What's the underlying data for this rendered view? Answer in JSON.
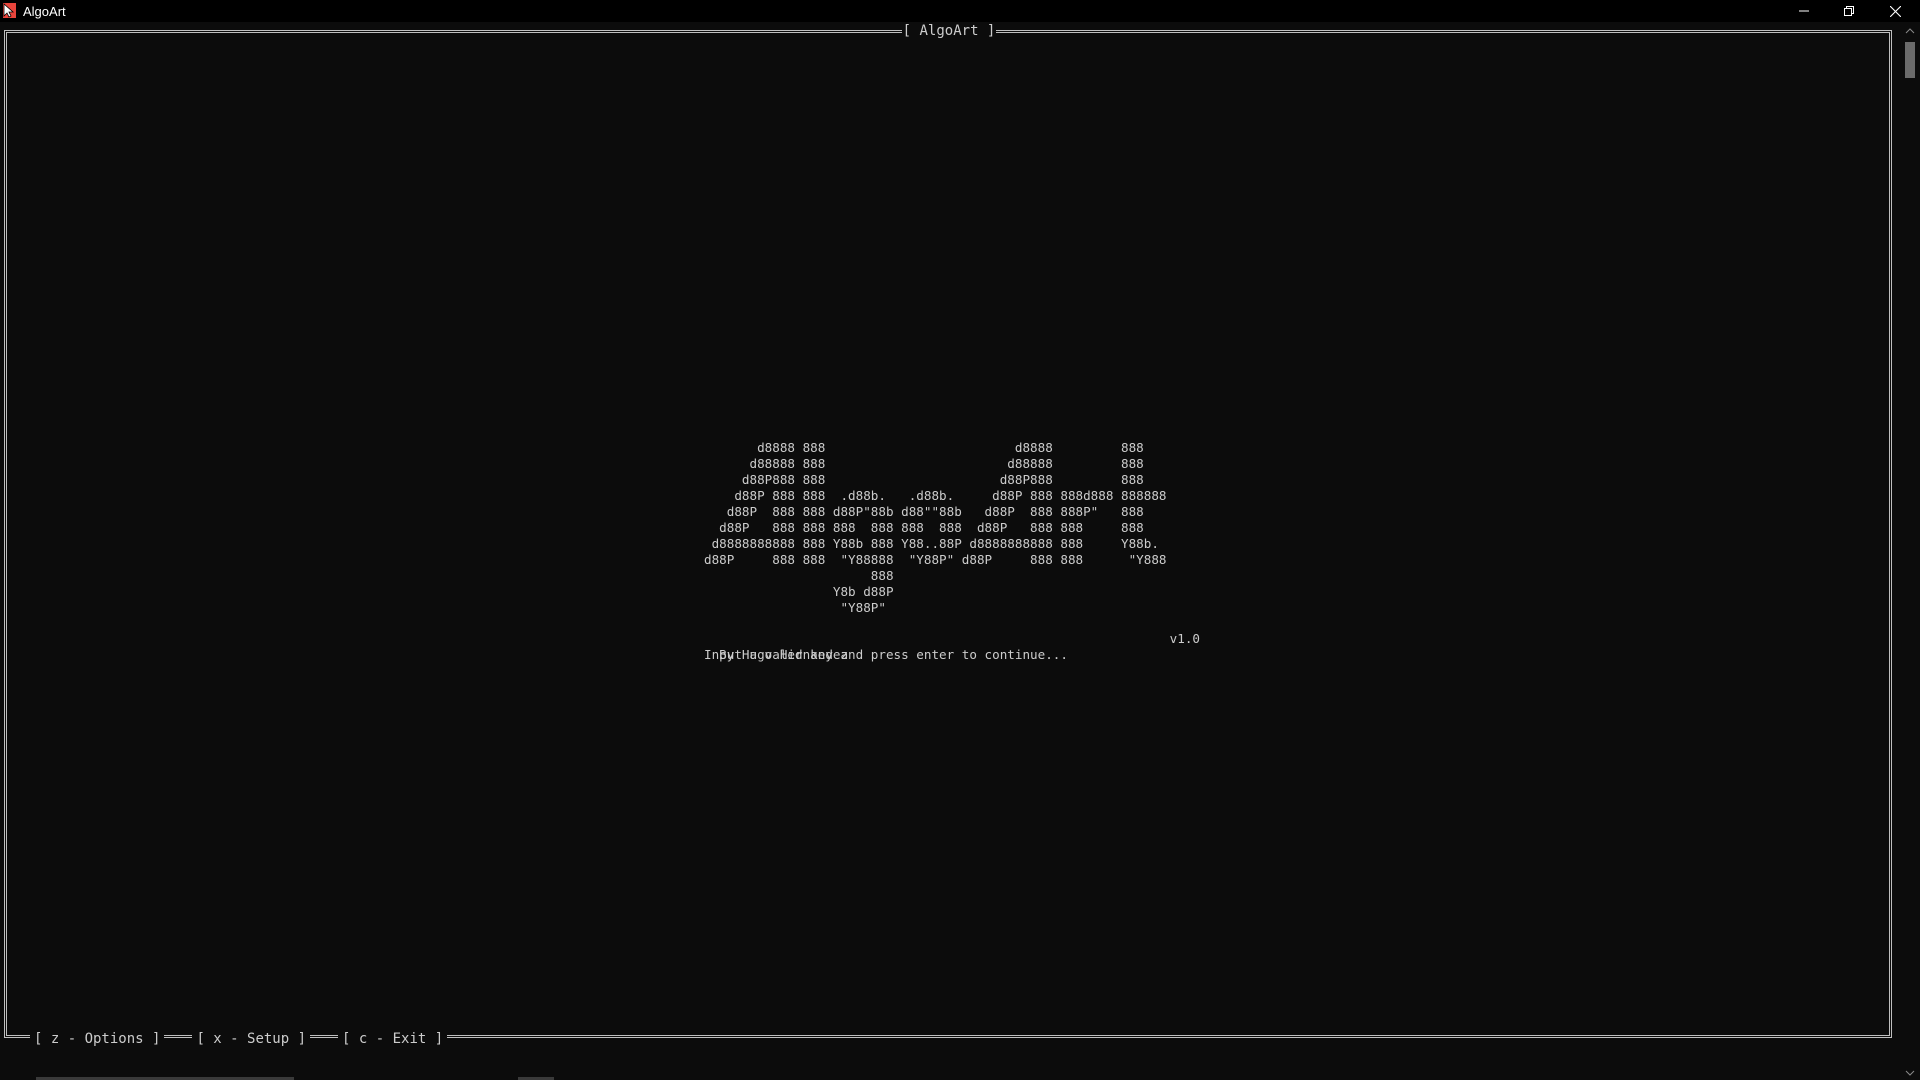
{
  "window": {
    "title": "AlgoArt"
  },
  "frame": {
    "title": "[ AlgoArt ]"
  },
  "menu": {
    "items": [
      {
        "label": "[ z - Options ]"
      },
      {
        "label": "[ x - Setup ]"
      },
      {
        "label": "[ c - Exit ]"
      }
    ]
  },
  "splash": {
    "logo": "       d8888 888                         d8888         888\n      d88888 888                        d88888         888\n     d88P888 888                       d88P888         888\n    d88P 888 888  .d88b.   .d88b.     d88P 888 888d888 888888\n   d88P  888 888 d88P\"88b d88\"\"88b   d88P  888 888P\"   888\n  d88P   888 888 888  888 888  888  d88P   888 888     888\n d8888888888 888 Y88b 888 Y88..88P d8888888888 888     Y88b.\nd88P     888 888  \"Y88888  \"Y88P\" d88P     888 888      \"Y888\n                      888\n                 Y8b d88P\n                  \"Y88P\"",
    "author": "By Hugo Hernandez",
    "version": "v1.0",
    "prompt": "Input a valid key and press enter to continue..."
  },
  "icons": {
    "app": "algoart-app-icon",
    "minimize": "minimize-icon",
    "maximize": "restore-icon",
    "close": "close-icon",
    "scroll_up": "chevron-up-icon",
    "scroll_down": "chevron-down-icon"
  },
  "colors": {
    "background": "#0c0c0c",
    "text": "#cccccc",
    "titlebar": "#000000",
    "app_icon": "#e8453c"
  }
}
